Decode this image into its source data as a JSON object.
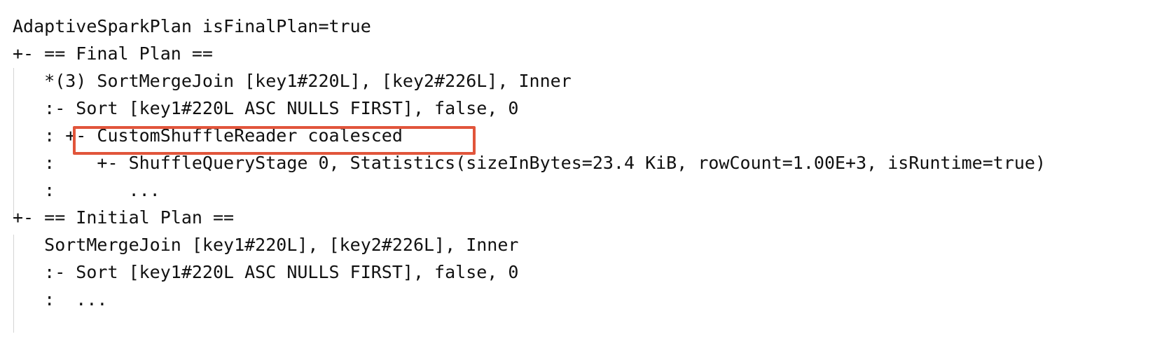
{
  "plan": {
    "lines": [
      "AdaptiveSparkPlan isFinalPlan=true",
      "+- == Final Plan ==",
      "   *(3) SortMergeJoin [key1#220L], [key2#226L], Inner",
      "   :- Sort [key1#220L ASC NULLS FIRST], false, 0",
      "   : +- CustomShuffleReader coalesced",
      "   :    +- ShuffleQueryStage 0, Statistics(sizeInBytes=23.4 KiB, rowCount=1.00E+3, isRuntime=true)",
      "   :       ...",
      "+- == Initial Plan ==",
      "   SortMergeJoin [key1#220L], [key2#226L], Inner",
      "   :- Sort [key1#220L ASC NULLS FIRST], false, 0",
      "   :  ..."
    ]
  },
  "colors": {
    "text": "#111111",
    "highlight_border": "#e1553b",
    "guide_line": "#d5d5d5",
    "background": "#ffffff"
  }
}
